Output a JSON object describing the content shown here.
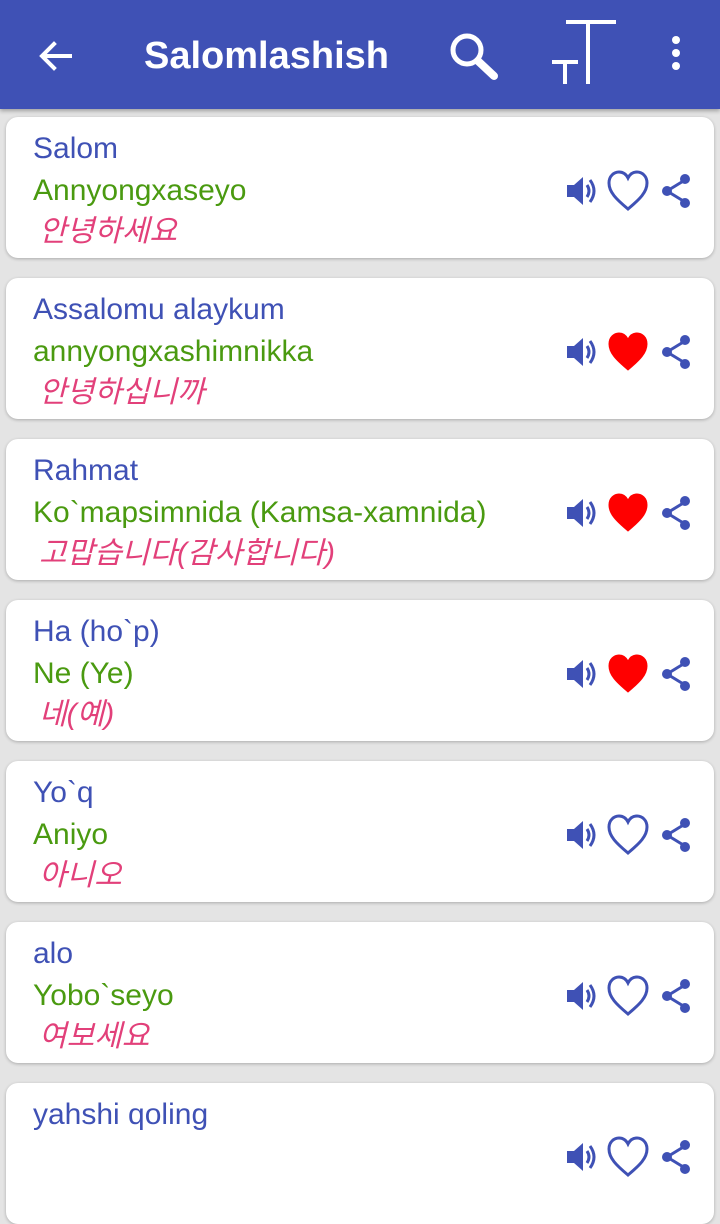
{
  "appbar": {
    "title": "Salomlashish",
    "back_icon": "arrow-back-icon",
    "search_icon": "search-icon",
    "text_size_icon": "text-size-icon",
    "menu_icon": "more-vert-icon",
    "color": "#3f51b5"
  },
  "colors": {
    "uzbek": "#3f51b5",
    "transliteration": "#4a9a10",
    "korean": "#e2407a",
    "favorite": "#ff0000"
  },
  "phrases": [
    {
      "uz": "Salom",
      "translit": "Annyongxaseyo",
      "ko": "안녕하세요",
      "favorite": false
    },
    {
      "uz": "Assalomu alaykum",
      "translit": "annyongxashimnikka",
      "ko": "안녕하십니까",
      "favorite": true
    },
    {
      "uz": "Rahmat",
      "translit": "Ko`mapsimnida (Kamsa-xamnida)",
      "ko": "고맙습니다(감사합니다)",
      "favorite": true
    },
    {
      "uz": "Ha (ho`p)",
      "translit": "Ne (Ye)",
      "ko": "네(예)",
      "favorite": true
    },
    {
      "uz": "Yo`q",
      "translit": "Aniyo",
      "ko": "아니오",
      "favorite": false
    },
    {
      "uz": "alo",
      "translit": "Yobo`seyo",
      "ko": "여보세요",
      "favorite": false
    },
    {
      "uz": "yahshi qoling",
      "translit": "",
      "ko": "",
      "favorite": false
    }
  ]
}
